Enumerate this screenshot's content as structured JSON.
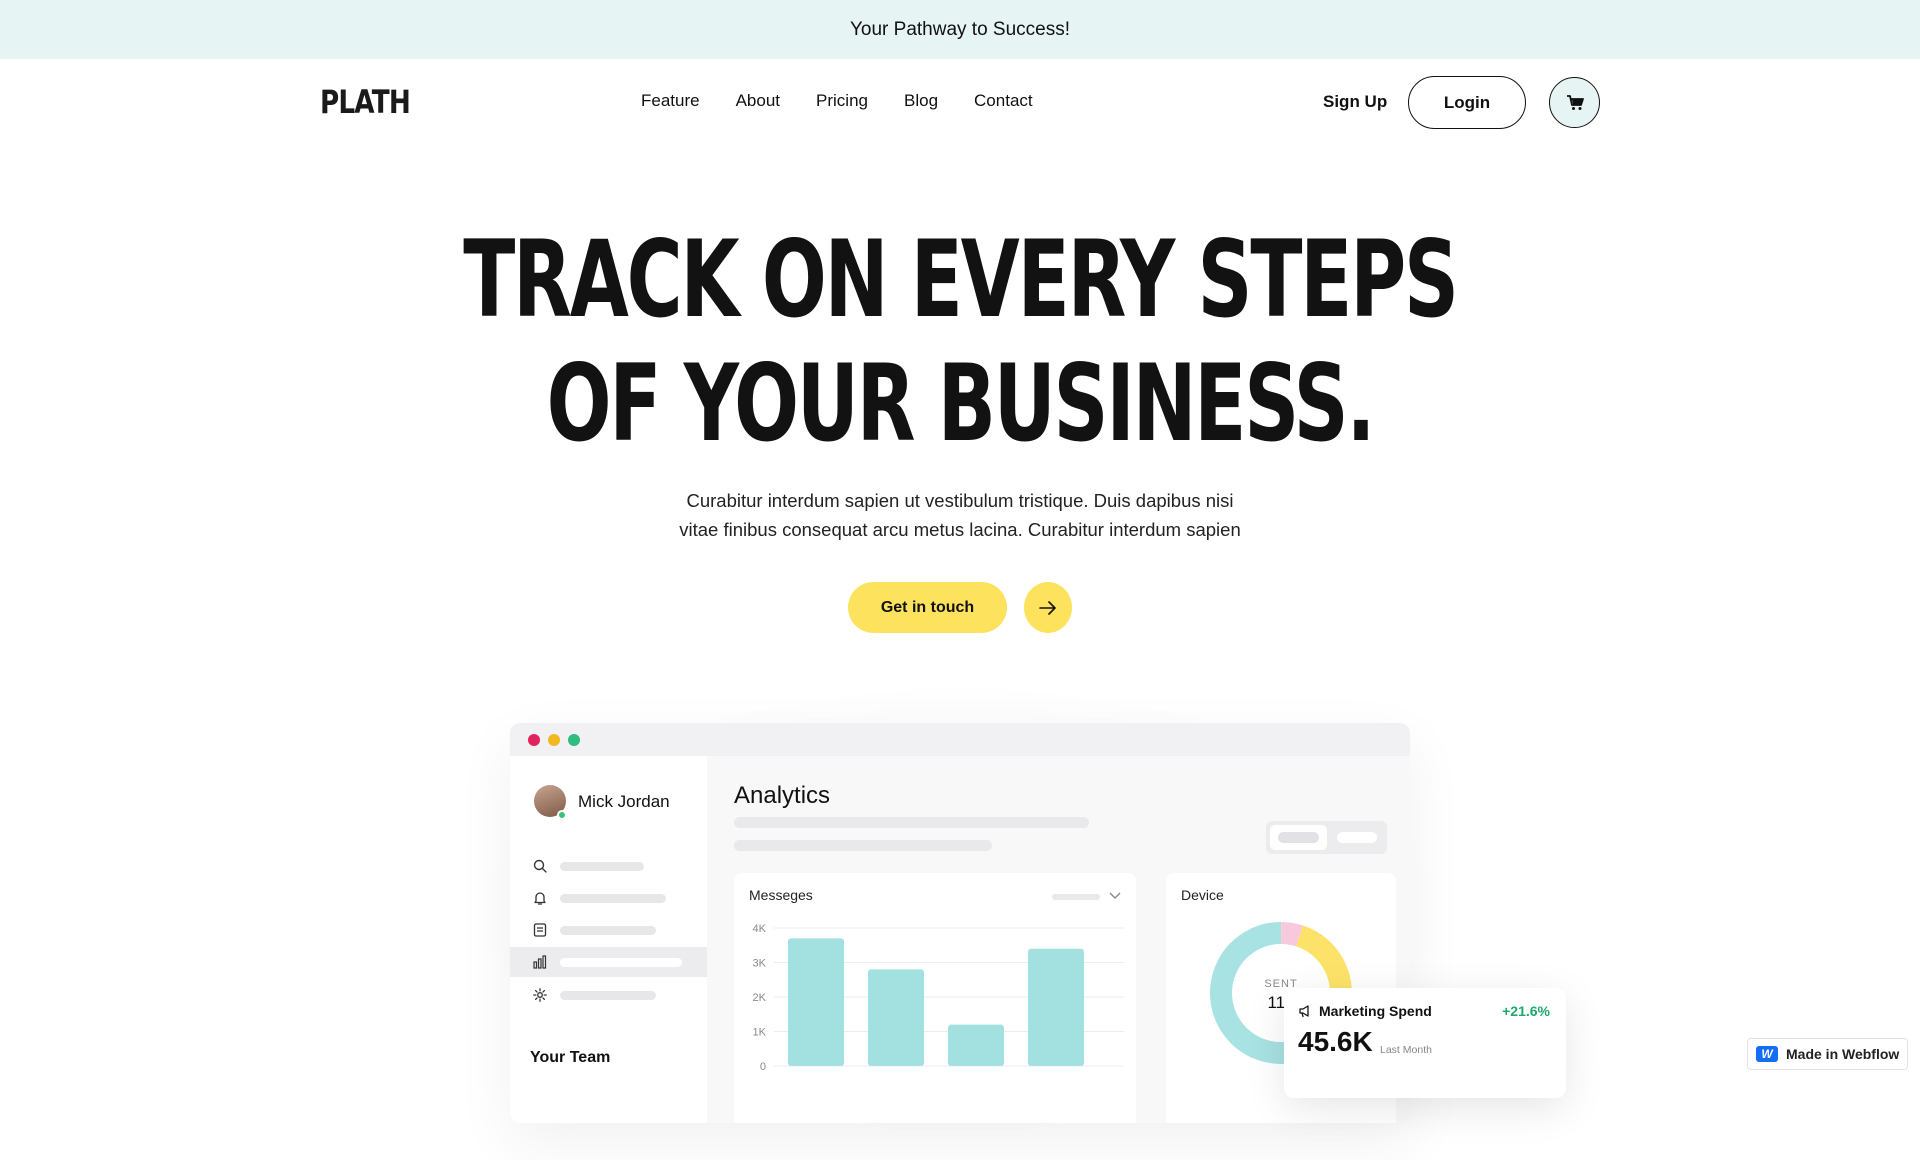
{
  "announcement": "Your Pathway to Success!",
  "brand": {
    "logo": "PLATH"
  },
  "nav": {
    "items": [
      "Feature",
      "About",
      "Pricing",
      "Blog",
      "Contact"
    ],
    "signup": "Sign Up",
    "login": "Login",
    "cart_icon": "cart-icon"
  },
  "hero": {
    "title_line1": "TRACK ON EVERY STEPS",
    "title_line2": "OF YOUR BUSINESS.",
    "subtitle_line1": "Curabitur interdum sapien ut vestibulum tristique. Duis dapibus nisi",
    "subtitle_line2": "vitae finibus consequat arcu metus lacina. Curabitur interdum sapien",
    "cta": "Get in touch",
    "cta_icon": "arrow-right-icon"
  },
  "dashboard": {
    "window_dots": [
      "#e0245e",
      "#f2b822",
      "#2ebd7d"
    ],
    "user_name": "Mick Jordan",
    "sidebar_icons": [
      "search-icon",
      "bell-icon",
      "document-icon",
      "chart-icon",
      "gear-icon"
    ],
    "team_label": "Your Team",
    "title": "Analytics",
    "messages_card": {
      "title": "Messeges",
      "chart_data": {
        "type": "bar",
        "categories": [
          "",
          "",
          "",
          ""
        ],
        "values": [
          3700,
          2800,
          1200,
          3400
        ],
        "ylim": [
          0,
          4000
        ],
        "yticks": [
          "0",
          "1K",
          "2K",
          "3K",
          "4K"
        ],
        "color": "#a3e0e0"
      }
    },
    "device_card": {
      "title": "Device",
      "center_label": "SENT",
      "center_value": "116",
      "segments": [
        {
          "value": 70,
          "color": "#a8e2e3"
        },
        {
          "value": 5,
          "color": "#f8c9dd"
        },
        {
          "value": 25,
          "color": "#fde26a"
        }
      ]
    }
  },
  "floating_card": {
    "title": "Marketing Spend",
    "delta": "+21.6%",
    "value": "45.6K",
    "period": "Last Month"
  },
  "badge": {
    "label": "Made in Webflow",
    "logo": "W"
  }
}
